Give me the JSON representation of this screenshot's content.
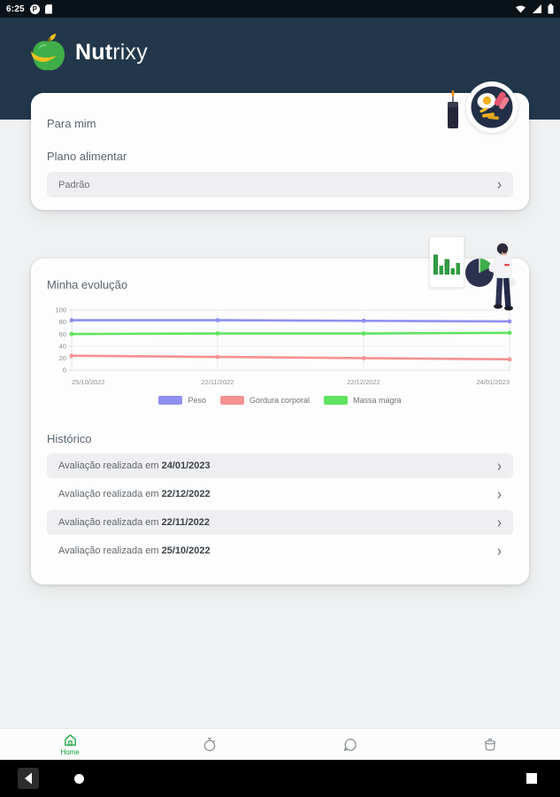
{
  "status_bar": {
    "time": "6:25",
    "left_icons": [
      "notification-p-icon",
      "sim-card-icon"
    ],
    "right_icons": [
      "wifi-icon",
      "signal-icon",
      "battery-icon"
    ]
  },
  "header": {
    "app_name_bold": "Nut",
    "app_name_light": "rixy",
    "logo": "apple-banana-logo"
  },
  "para_mim": {
    "title": "Para mim",
    "plan_label": "Plano alimentar",
    "plan_value": "Padrão"
  },
  "evolution": {
    "title": "Minha evolução",
    "history_title": "Histórico",
    "history_items": [
      {
        "prefix": "Avaliação realizada em",
        "date": "24/01/2023"
      },
      {
        "prefix": "Avaliação realizada em",
        "date": "22/12/2022"
      },
      {
        "prefix": "Avaliação realizada em",
        "date": "22/11/2022"
      },
      {
        "prefix": "Avaliação realizada em",
        "date": "25/10/2022"
      }
    ]
  },
  "chart_data": {
    "type": "line",
    "title": "",
    "xlabel": "",
    "ylabel": "",
    "x": [
      "25/10/2022",
      "22/11/2022",
      "22/12/2022",
      "24/01/2023"
    ],
    "series": [
      {
        "name": "Peso",
        "color": "#8f8ff2",
        "values": [
          83,
          83,
          82,
          81
        ]
      },
      {
        "name": "Gordura corporal",
        "color": "#f59292",
        "values": [
          24,
          22,
          20,
          18
        ]
      },
      {
        "name": "Massa magra",
        "color": "#5fe45f",
        "values": [
          60,
          61,
          61,
          62
        ]
      }
    ],
    "ylim": [
      0,
      100
    ],
    "yticks": [
      0,
      20,
      40,
      60,
      80,
      100
    ],
    "grid": true,
    "legend_position": "bottom"
  },
  "bottom_nav": {
    "items": [
      {
        "label": "Home",
        "icon": "home-icon",
        "active": true
      },
      {
        "label": "",
        "icon": "timer-icon",
        "active": false
      },
      {
        "label": "",
        "icon": "chat-icon",
        "active": false
      },
      {
        "label": "",
        "icon": "pot-icon",
        "active": false
      }
    ]
  },
  "icons": {
    "chevron_right": "›"
  },
  "colors": {
    "header_navy": "#22384a",
    "brand_green": "#3fae49",
    "active_nav_green": "#12a43e",
    "card_bg": "#fdfdfe",
    "row_gray": "#efeff1"
  }
}
